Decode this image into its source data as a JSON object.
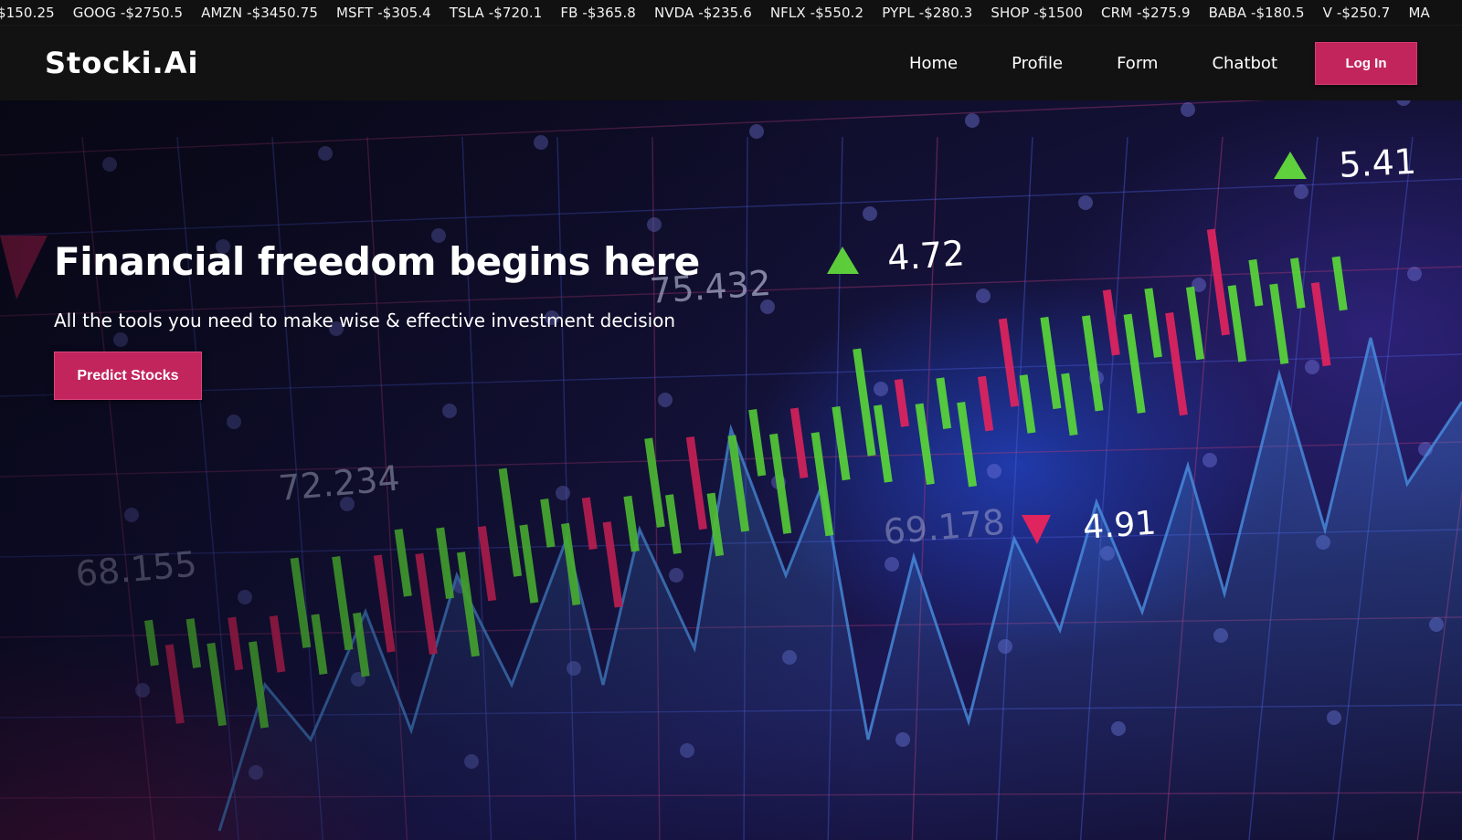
{
  "ticker": {
    "items": [
      "$150.25",
      "GOOG -$2750.5",
      "AMZN -$3450.75",
      "MSFT -$305.4",
      "TSLA -$720.1",
      "FB -$365.8",
      "NVDA -$235.6",
      "NFLX -$550.2",
      "PYPL -$280.3",
      "SHOP -$1500",
      "CRM -$275.9",
      "BABA -$180.5",
      "V -$250.7",
      "MA"
    ]
  },
  "navbar": {
    "brand": "Stocki.Ai",
    "links": [
      "Home",
      "Profile",
      "Form",
      "Chatbot"
    ],
    "login_label": "Log In"
  },
  "hero": {
    "title": "Financial freedom begins here",
    "subtitle": "All the tools you need to make wise & effective investment decision",
    "cta_label": "Predict Stocks",
    "background_labels": [
      "75.432",
      "72.234",
      "68.155",
      "69.178",
      "4.72",
      "4.91",
      "5.41"
    ]
  },
  "colors": {
    "accent": "#c2255c",
    "bull": "#59d63a",
    "bear": "#e0245e",
    "grid_blue": "#4a5bd8",
    "grid_pink": "#b03a78"
  }
}
